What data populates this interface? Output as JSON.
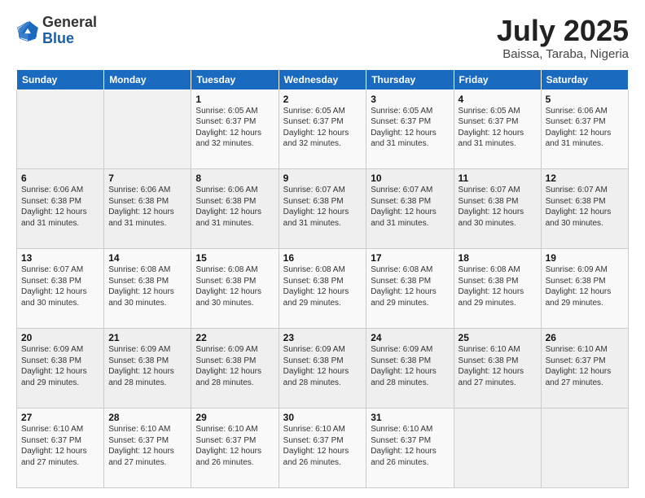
{
  "header": {
    "logo_general": "General",
    "logo_blue": "Blue",
    "title": "July 2025",
    "subtitle": "Baissa, Taraba, Nigeria"
  },
  "calendar": {
    "days_of_week": [
      "Sunday",
      "Monday",
      "Tuesday",
      "Wednesday",
      "Thursday",
      "Friday",
      "Saturday"
    ],
    "weeks": [
      [
        {
          "day": "",
          "info": ""
        },
        {
          "day": "",
          "info": ""
        },
        {
          "day": "1",
          "info": "Sunrise: 6:05 AM\nSunset: 6:37 PM\nDaylight: 12 hours and 32 minutes."
        },
        {
          "day": "2",
          "info": "Sunrise: 6:05 AM\nSunset: 6:37 PM\nDaylight: 12 hours and 32 minutes."
        },
        {
          "day": "3",
          "info": "Sunrise: 6:05 AM\nSunset: 6:37 PM\nDaylight: 12 hours and 31 minutes."
        },
        {
          "day": "4",
          "info": "Sunrise: 6:05 AM\nSunset: 6:37 PM\nDaylight: 12 hours and 31 minutes."
        },
        {
          "day": "5",
          "info": "Sunrise: 6:06 AM\nSunset: 6:37 PM\nDaylight: 12 hours and 31 minutes."
        }
      ],
      [
        {
          "day": "6",
          "info": "Sunrise: 6:06 AM\nSunset: 6:38 PM\nDaylight: 12 hours and 31 minutes."
        },
        {
          "day": "7",
          "info": "Sunrise: 6:06 AM\nSunset: 6:38 PM\nDaylight: 12 hours and 31 minutes."
        },
        {
          "day": "8",
          "info": "Sunrise: 6:06 AM\nSunset: 6:38 PM\nDaylight: 12 hours and 31 minutes."
        },
        {
          "day": "9",
          "info": "Sunrise: 6:07 AM\nSunset: 6:38 PM\nDaylight: 12 hours and 31 minutes."
        },
        {
          "day": "10",
          "info": "Sunrise: 6:07 AM\nSunset: 6:38 PM\nDaylight: 12 hours and 31 minutes."
        },
        {
          "day": "11",
          "info": "Sunrise: 6:07 AM\nSunset: 6:38 PM\nDaylight: 12 hours and 30 minutes."
        },
        {
          "day": "12",
          "info": "Sunrise: 6:07 AM\nSunset: 6:38 PM\nDaylight: 12 hours and 30 minutes."
        }
      ],
      [
        {
          "day": "13",
          "info": "Sunrise: 6:07 AM\nSunset: 6:38 PM\nDaylight: 12 hours and 30 minutes."
        },
        {
          "day": "14",
          "info": "Sunrise: 6:08 AM\nSunset: 6:38 PM\nDaylight: 12 hours and 30 minutes."
        },
        {
          "day": "15",
          "info": "Sunrise: 6:08 AM\nSunset: 6:38 PM\nDaylight: 12 hours and 30 minutes."
        },
        {
          "day": "16",
          "info": "Sunrise: 6:08 AM\nSunset: 6:38 PM\nDaylight: 12 hours and 29 minutes."
        },
        {
          "day": "17",
          "info": "Sunrise: 6:08 AM\nSunset: 6:38 PM\nDaylight: 12 hours and 29 minutes."
        },
        {
          "day": "18",
          "info": "Sunrise: 6:08 AM\nSunset: 6:38 PM\nDaylight: 12 hours and 29 minutes."
        },
        {
          "day": "19",
          "info": "Sunrise: 6:09 AM\nSunset: 6:38 PM\nDaylight: 12 hours and 29 minutes."
        }
      ],
      [
        {
          "day": "20",
          "info": "Sunrise: 6:09 AM\nSunset: 6:38 PM\nDaylight: 12 hours and 29 minutes."
        },
        {
          "day": "21",
          "info": "Sunrise: 6:09 AM\nSunset: 6:38 PM\nDaylight: 12 hours and 28 minutes."
        },
        {
          "day": "22",
          "info": "Sunrise: 6:09 AM\nSunset: 6:38 PM\nDaylight: 12 hours and 28 minutes."
        },
        {
          "day": "23",
          "info": "Sunrise: 6:09 AM\nSunset: 6:38 PM\nDaylight: 12 hours and 28 minutes."
        },
        {
          "day": "24",
          "info": "Sunrise: 6:09 AM\nSunset: 6:38 PM\nDaylight: 12 hours and 28 minutes."
        },
        {
          "day": "25",
          "info": "Sunrise: 6:10 AM\nSunset: 6:38 PM\nDaylight: 12 hours and 27 minutes."
        },
        {
          "day": "26",
          "info": "Sunrise: 6:10 AM\nSunset: 6:37 PM\nDaylight: 12 hours and 27 minutes."
        }
      ],
      [
        {
          "day": "27",
          "info": "Sunrise: 6:10 AM\nSunset: 6:37 PM\nDaylight: 12 hours and 27 minutes."
        },
        {
          "day": "28",
          "info": "Sunrise: 6:10 AM\nSunset: 6:37 PM\nDaylight: 12 hours and 27 minutes."
        },
        {
          "day": "29",
          "info": "Sunrise: 6:10 AM\nSunset: 6:37 PM\nDaylight: 12 hours and 26 minutes."
        },
        {
          "day": "30",
          "info": "Sunrise: 6:10 AM\nSunset: 6:37 PM\nDaylight: 12 hours and 26 minutes."
        },
        {
          "day": "31",
          "info": "Sunrise: 6:10 AM\nSunset: 6:37 PM\nDaylight: 12 hours and 26 minutes."
        },
        {
          "day": "",
          "info": ""
        },
        {
          "day": "",
          "info": ""
        }
      ]
    ]
  }
}
